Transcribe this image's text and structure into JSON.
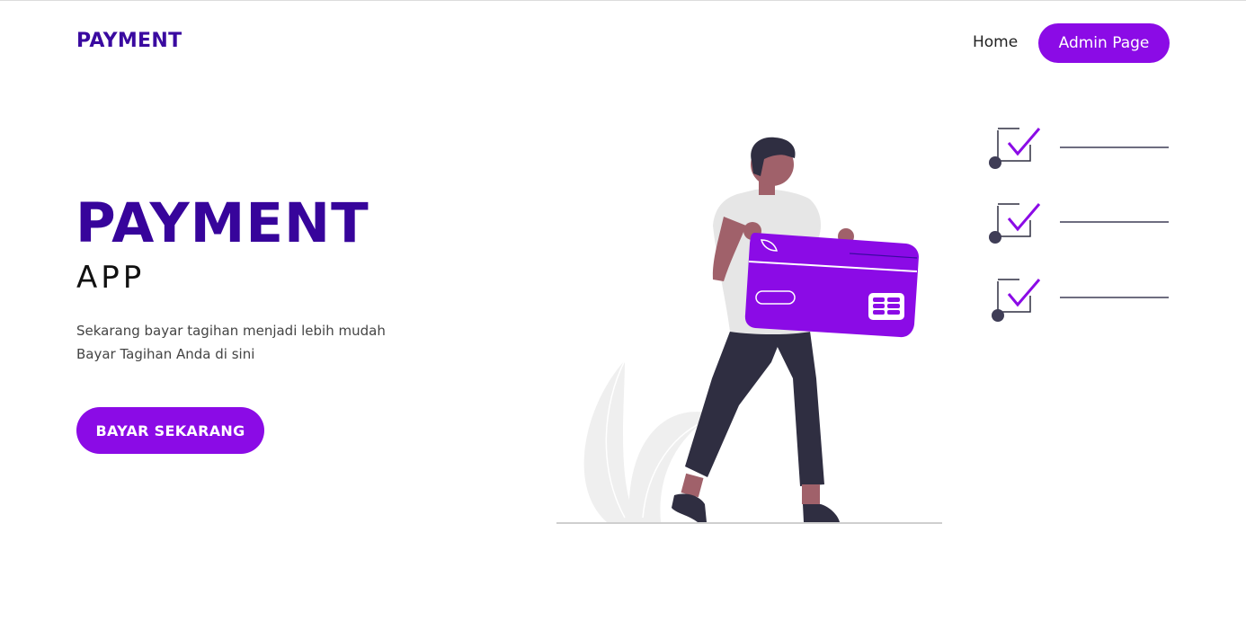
{
  "navbar": {
    "brand": "PAYMENT",
    "home_label": "Home",
    "admin_label": "Admin Page"
  },
  "hero": {
    "title": "PAYMENT",
    "subtitle": "APP",
    "description_line1": "Sekarang bayar tagihan menjadi lebih mudah",
    "description_line2": "Bayar Tagihan Anda di sini",
    "cta_label": "BAYAR SEKARANG"
  },
  "colors": {
    "accent": "#8b0be6",
    "brand": "#37049b",
    "dark": "#2f2e41",
    "skin": "#a0616a"
  },
  "illustration": {
    "checklist_items": 3
  }
}
